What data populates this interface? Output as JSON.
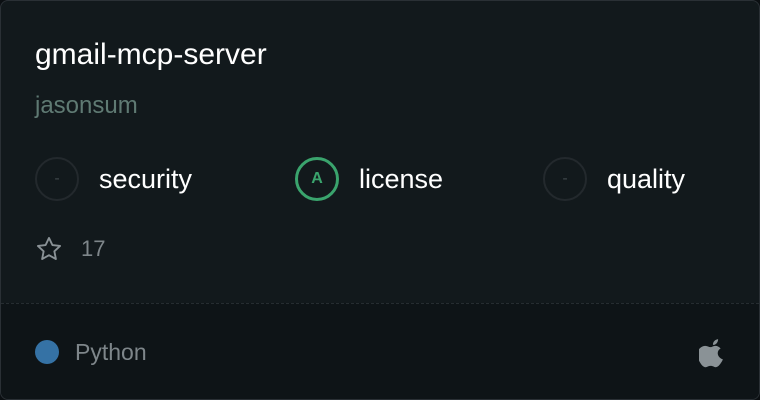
{
  "repo": {
    "name": "gmail-mcp-server",
    "author": "jasonsum"
  },
  "scores": [
    {
      "grade": "-",
      "label": "security"
    },
    {
      "grade": "A",
      "label": "license"
    },
    {
      "grade": "-",
      "label": "quality"
    }
  ],
  "stars": {
    "icon": "star-icon",
    "count": "17"
  },
  "footer": {
    "language": "Python",
    "language_color": "#3572a5",
    "platform_icon": "apple-icon"
  }
}
